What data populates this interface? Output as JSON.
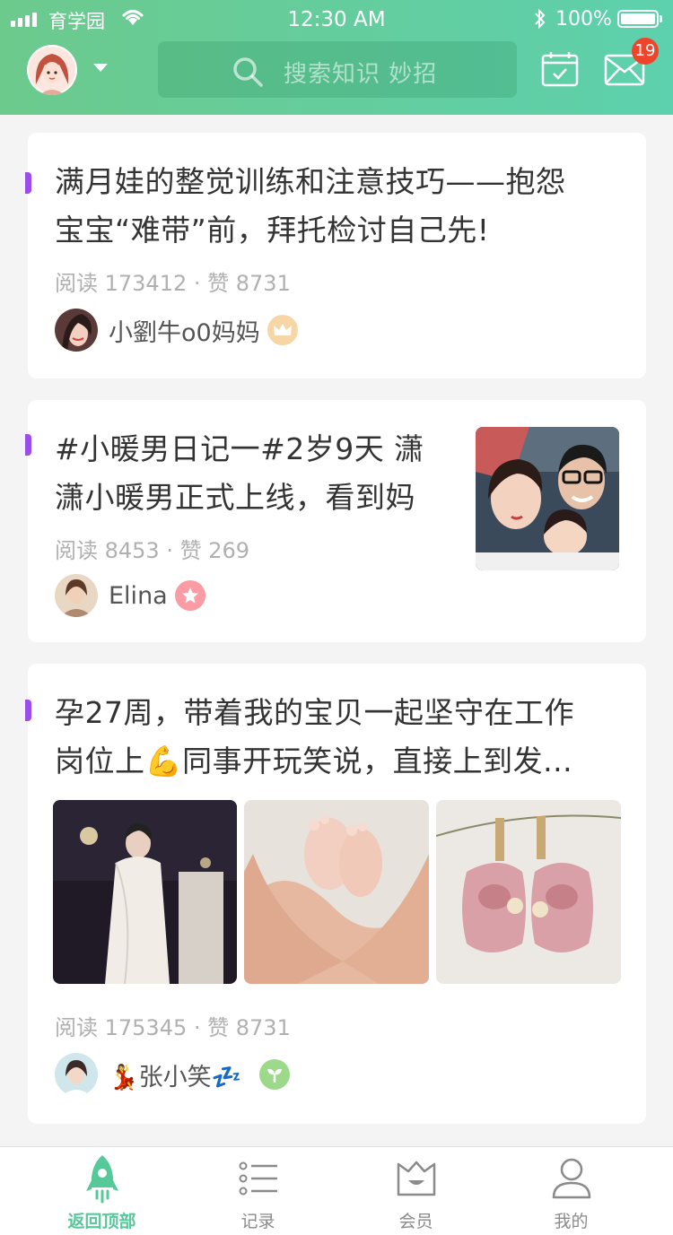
{
  "status_bar": {
    "carrier": "育学园",
    "time": "12:30 AM",
    "battery": "100%"
  },
  "header": {
    "search_placeholder": "搜索知识 妙招",
    "notification_count": "19"
  },
  "feed": [
    {
      "title_lines": [
        "满月娃的整觉训练和注意技巧——抱怨",
        "宝宝“难带”前，拜托检讨自己先!"
      ],
      "meta": "阅读 173412 · 赞 8731",
      "author": "小劉牛o0妈妈",
      "badge": "crown"
    },
    {
      "title_lines": [
        "#小暖男日记一#2岁9天 潇",
        "潇小暖男正式上线，看到妈"
      ],
      "meta": "阅读 8453 · 赞 269",
      "author": "Elina",
      "badge": "star"
    },
    {
      "title_lines": [
        "孕27周，带着我的宝贝一起坚守在工作",
        "岗位上💪同事开玩笑说，直接上到发..."
      ],
      "meta": "阅读 175345 · 赞 8731",
      "author": "💃张小笑💤",
      "badge": "sprout"
    }
  ],
  "tabbar": {
    "tabs": [
      {
        "label": "返回顶部",
        "icon": "rocket-icon"
      },
      {
        "label": "记录",
        "icon": "list-icon"
      },
      {
        "label": "会员",
        "icon": "crown-box-icon"
      },
      {
        "label": "我的",
        "icon": "person-icon"
      }
    ]
  },
  "colors": {
    "header_start": "#6cca8d",
    "header_end": "#5dd0ad",
    "accent": "#55c99a",
    "marker": "#9b4dea",
    "badge": "#f0432c"
  }
}
